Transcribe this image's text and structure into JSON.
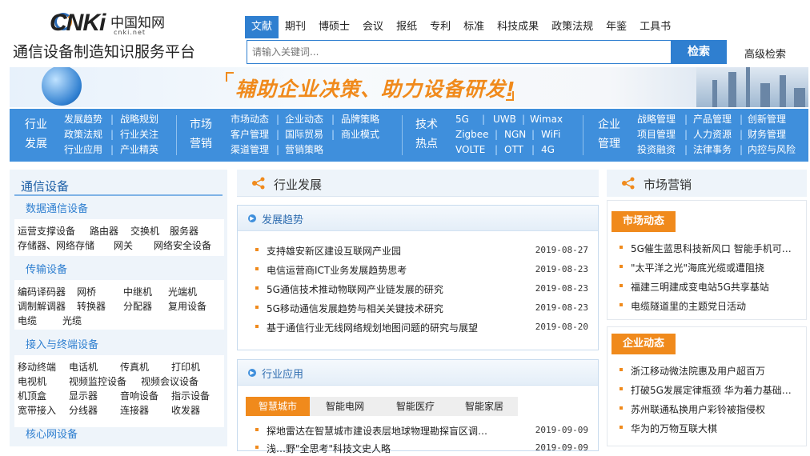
{
  "logo": {
    "cnki": "CNKi",
    "cn": "中国知网",
    "url": "cnki.net"
  },
  "site_title": "通信设备制造知识服务平台",
  "nav": [
    "文献",
    "期刊",
    "博硕士",
    "会议",
    "报纸",
    "专利",
    "标准",
    "科技成果",
    "政策法规",
    "年鉴",
    "工具书"
  ],
  "search": {
    "placeholder": "请输入关键词...",
    "button": "检索",
    "advanced": "高级检索"
  },
  "banner": {
    "slogan": "辅助企业决策、助力设备研发!"
  },
  "categories": {
    "industry": {
      "title1": "行业",
      "title2": "发展",
      "links": [
        "发展趋势",
        "战略规划",
        "政策法规",
        "行业关注",
        "行业应用",
        "产业精英"
      ]
    },
    "market": {
      "title1": "市场",
      "title2": "营销",
      "links": [
        "市场动态",
        "企业动态",
        "品牌策略",
        "客户管理",
        "国际贸易",
        "商业模式",
        "渠道管理",
        "营销策略"
      ]
    },
    "tech": {
      "title1": "技术",
      "title2": "热点",
      "links": [
        "5G",
        "UWB",
        "Wimax",
        "Zigbee",
        "NGN",
        "WiFi",
        "VOLTE",
        "OTT",
        "4G"
      ]
    },
    "enterprise": {
      "title1": "企业",
      "title2": "管理",
      "links": [
        "战略管理",
        "产品管理",
        "创新管理",
        "项目管理",
        "人力资源",
        "财务管理",
        "投资融资",
        "法律事务",
        "内控与风险"
      ]
    }
  },
  "left": {
    "heading": "通信设备",
    "groups": [
      {
        "title": "数据通信设备",
        "items": [
          "运营支撑设备",
          "路由器",
          "交换机",
          "服务器",
          "存储器、网络存储",
          "网关",
          "网络安全设备"
        ]
      },
      {
        "title": "传输设备",
        "items": [
          "编码译码器",
          "网桥",
          "中继机",
          "光端机",
          "调制解调器",
          "转换器",
          "分配器",
          "复用设备",
          "电缆",
          "光缆"
        ]
      },
      {
        "title": "接入与终端设备",
        "items": [
          "移动终端",
          "电话机",
          "传真机",
          "打印机",
          "电视机",
          "视频监控设备",
          "视频会议设备",
          "机顶盒",
          "显示器",
          "音响设备",
          "指示设备",
          "宽带接入",
          "分线器",
          "连接器",
          "收发器"
        ]
      },
      {
        "title": "核心网设备",
        "items": []
      }
    ]
  },
  "middle": {
    "heading": "行业发展",
    "trend": {
      "title": "发展趋势",
      "rows": [
        {
          "t": "支持雄安新区建设互联网产业园",
          "d": "2019-08-27"
        },
        {
          "t": "电信运营商ICT业务发展趋势思考",
          "d": "2019-08-23"
        },
        {
          "t": "5G通信技术推动物联网产业链发展的研究",
          "d": "2019-08-23"
        },
        {
          "t": "5G移动通信发展趋势与相关关键技术研究",
          "d": "2019-08-23"
        },
        {
          "t": "基于通信行业无线网络规划地图问题的研究与展望",
          "d": "2019-08-20"
        }
      ]
    },
    "app": {
      "title": "行业应用",
      "tabs": [
        "智慧城市",
        "智能电网",
        "智能医疗",
        "智能家居"
      ],
      "rows": [
        {
          "t": "探地雷达在智慧城市建设表层地球物理勘探盲区调…",
          "d": "2019-09-09"
        },
        {
          "t": "浅…野\"全思考\"科技文史人略",
          "d": "2019-09-09"
        }
      ]
    }
  },
  "right": {
    "heading": "市场营销",
    "market_tag": "市场动态",
    "market_rows": [
      "5G催生蓝思科技新风口 智能手机可…",
      "\"太平洋之光\"海底光缆或遭阻挠",
      "福建三明建成变电站5G共享基站",
      "电缆隧道里的主题党日活动"
    ],
    "enterprise_tag": "企业动态",
    "enterprise_rows": [
      "浙江移动微法院惠及用户超百万",
      "打破5G发展定律瓶颈 华为着力基础…",
      "苏州联通私换用户彩铃被指侵权",
      "华为的万物互联大棋"
    ]
  },
  "colors": {
    "blue": "#3f8fdc",
    "orange": "#f08a1c"
  }
}
